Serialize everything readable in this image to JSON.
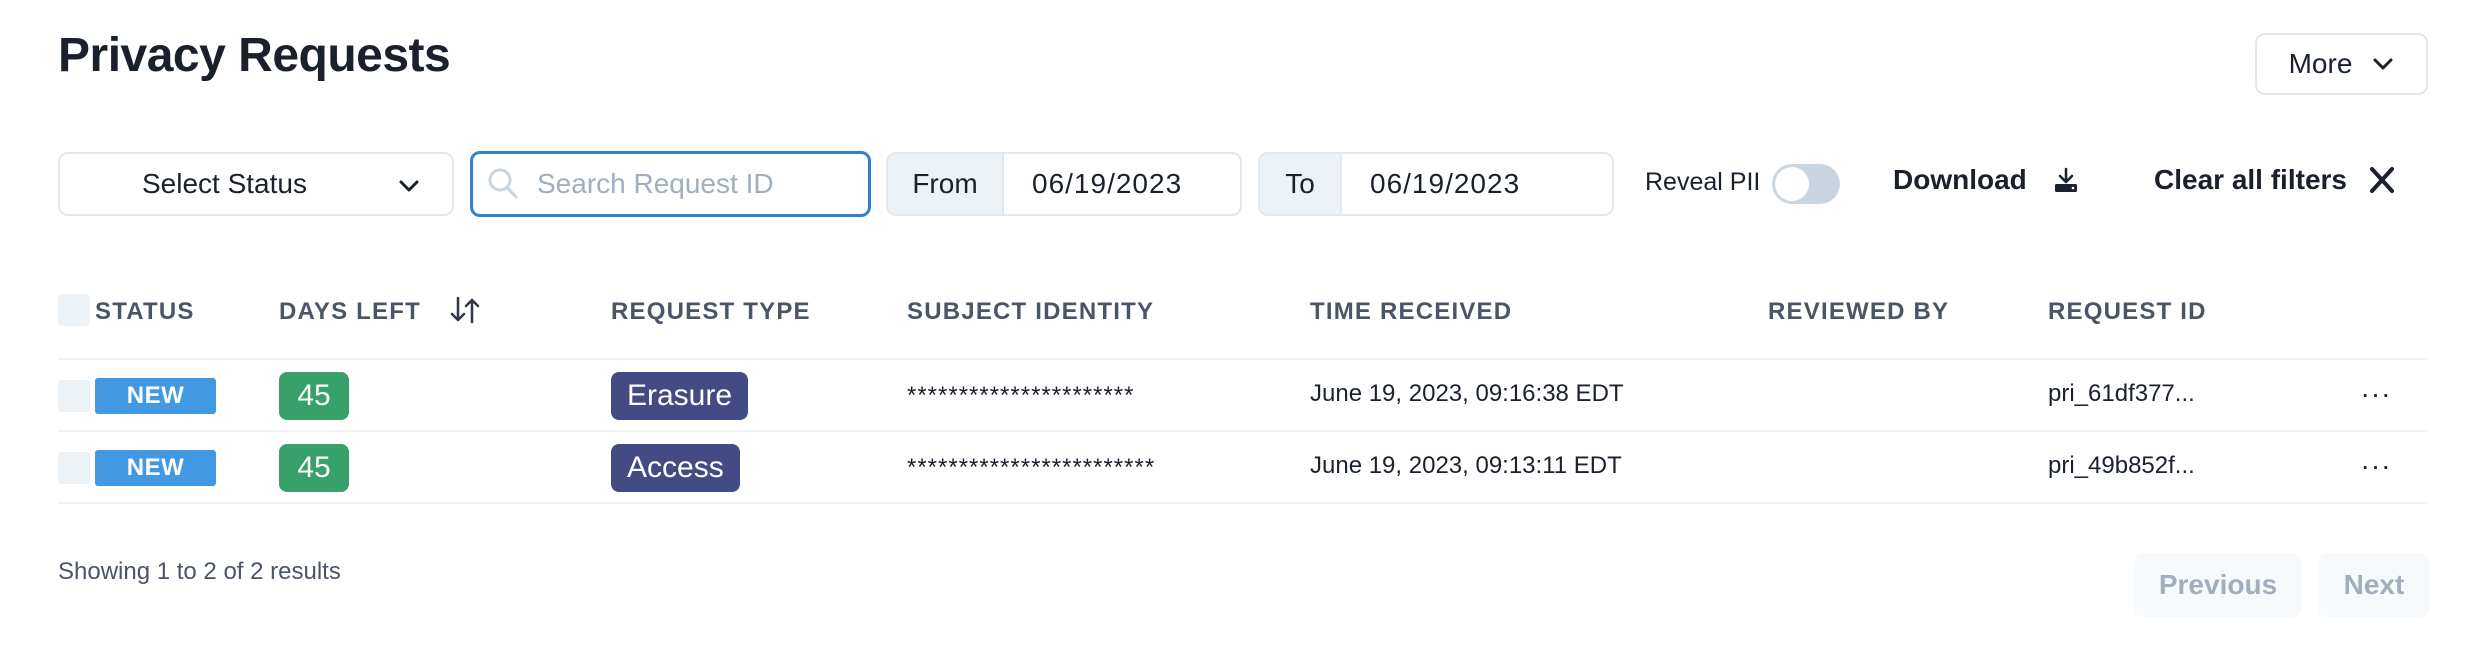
{
  "header": {
    "title": "Privacy Requests",
    "more_label": "More",
    "more_icon": "chevron-down-icon"
  },
  "filters": {
    "status_select": {
      "label": "Select Status",
      "icon": "chevron-down-icon"
    },
    "search": {
      "placeholder": "Search Request ID",
      "value": "",
      "icon": "search-icon"
    },
    "from": {
      "label": "From",
      "value": "06/19/2023"
    },
    "to": {
      "label": "To",
      "value": "06/19/2023"
    },
    "reveal_pii": {
      "label": "Reveal PII",
      "checked": false
    },
    "download": {
      "label": "Download",
      "icon": "download-icon"
    },
    "clear": {
      "label": "Clear all filters",
      "icon": "close-icon"
    }
  },
  "table": {
    "columns": [
      "Status",
      "Days Left",
      "Request Type",
      "Subject Identity",
      "Time Received",
      "Reviewed By",
      "Request ID"
    ],
    "sort_icon": "sort-arrows-icon",
    "rows": [
      {
        "status": "NEW",
        "days_left": "45",
        "request_type": "Erasure",
        "subject_identity": "**********************",
        "time_received": "June 19, 2023, 09:16:38 EDT",
        "reviewed_by": "",
        "request_id": "pri_61df377...",
        "actions": "···"
      },
      {
        "status": "NEW",
        "days_left": "45",
        "request_type": "Access",
        "subject_identity": "************************",
        "time_received": "June 19, 2023, 09:13:11 EDT",
        "reviewed_by": "",
        "request_id": "pri_49b852f...",
        "actions": "···"
      }
    ]
  },
  "pagination": {
    "summary": "Showing 1 to 2 of 2 results",
    "previous_label": "Previous",
    "next_label": "Next",
    "previous_disabled": true,
    "next_disabled": true
  },
  "colors": {
    "status_new": "#4299e1",
    "days_left": "#38a169",
    "request_type": "#434b84",
    "focus": "#3182ce"
  }
}
